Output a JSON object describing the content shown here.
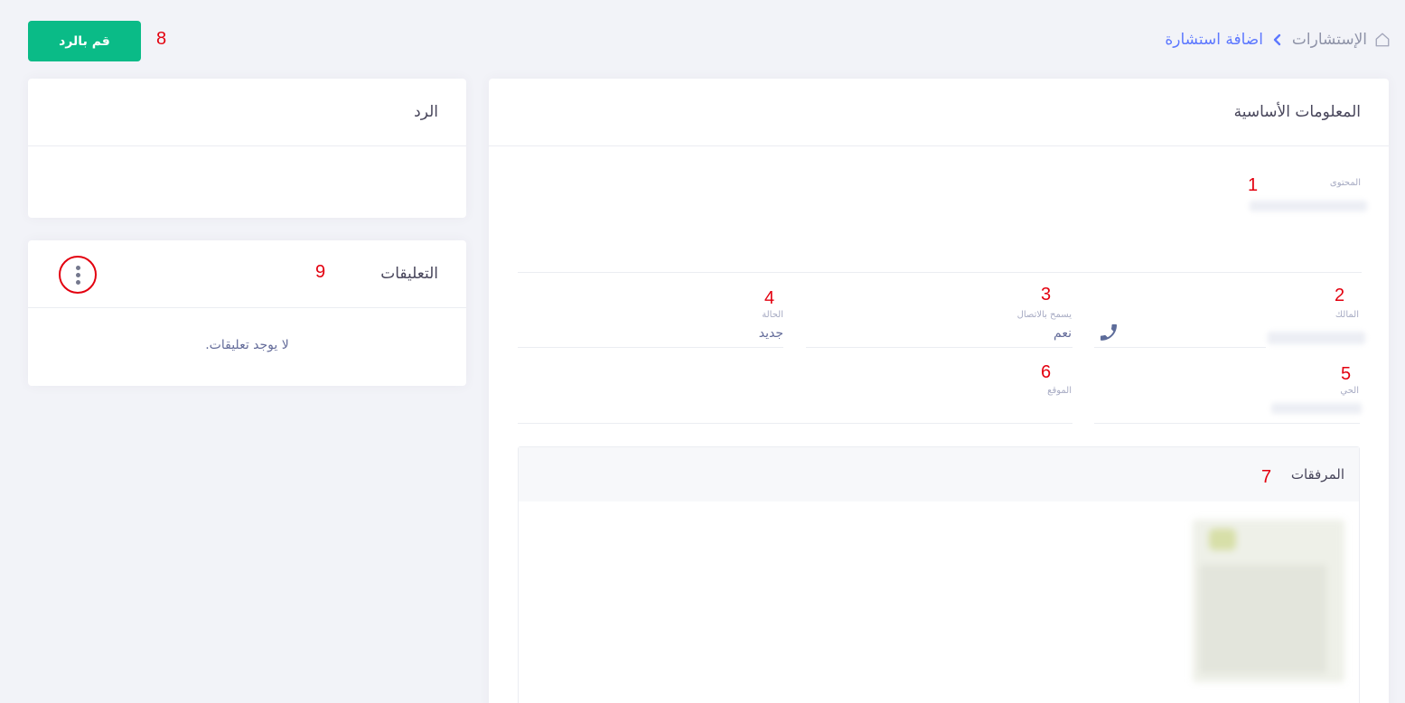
{
  "breadcrumb": {
    "home_icon": "home-icon",
    "root": "الإستشارات",
    "separator_icon": "chevron-left-icon",
    "current": "اضافة استشارة"
  },
  "actions": {
    "reply_label": "قم بالرد"
  },
  "basic_info": {
    "title": "المعلومات الأساسية",
    "content_label": "المحتوى",
    "owner_label": "المالك",
    "owner_icon": "phone-icon",
    "allow_contact_label": "يسمح بالاتصال",
    "allow_contact_value": "نعم",
    "status_label": "الحالة",
    "status_value": "جديد",
    "district_label": "الحي",
    "location_label": "الموقع"
  },
  "attachments": {
    "title": "المرفقات"
  },
  "reply": {
    "title": "الرد"
  },
  "comments": {
    "title": "التعليقات",
    "menu_icon": "more-vertical-icon",
    "empty": "لا يوجد تعليقات."
  },
  "annotations": [
    "1",
    "2",
    "3",
    "4",
    "5",
    "6",
    "7",
    "8",
    "9"
  ],
  "colors": {
    "primary": "#5d78ff",
    "success": "#0abb87",
    "annotation": "#e3000f"
  }
}
